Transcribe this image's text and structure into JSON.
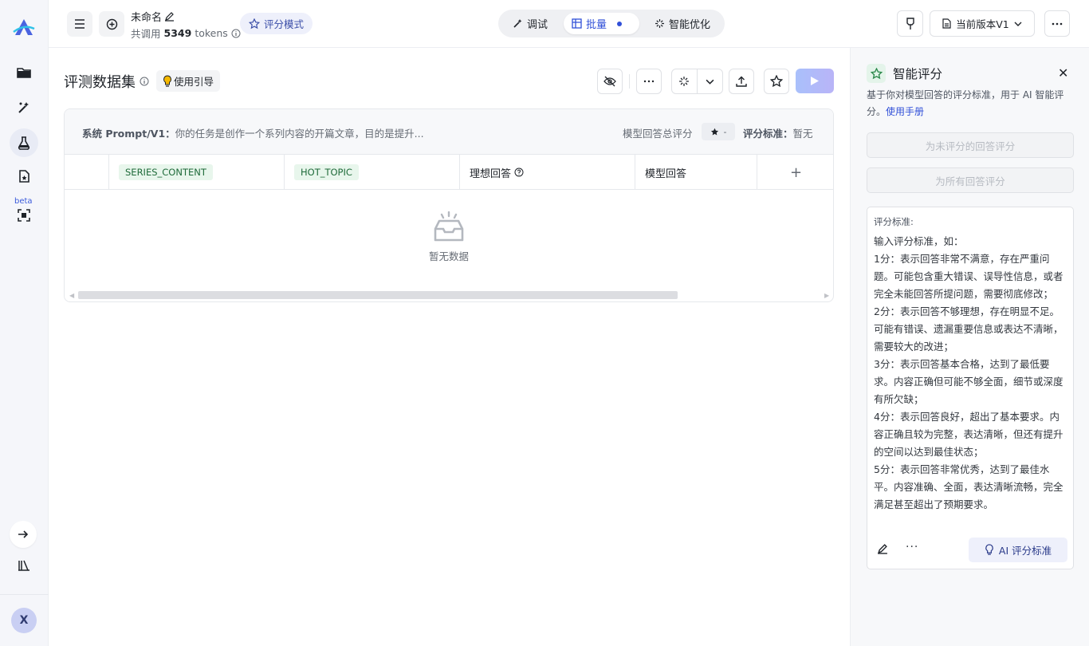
{
  "rail": {
    "beta_label": "beta",
    "avatar_initial": "X"
  },
  "topbar": {
    "title": "未命名",
    "usage_prefix": "共调用",
    "usage_tokens": "5349",
    "usage_unit": "tokens",
    "score_mode_label": "评分模式",
    "tabs": [
      {
        "label": "调试",
        "active": false
      },
      {
        "label": "批量",
        "active": true
      },
      {
        "label": "智能优化",
        "active": false
      }
    ],
    "version_label": "当前版本V1"
  },
  "main": {
    "dataset_title": "评测数据集",
    "guide_label": "使用引导",
    "prompt_prefix": "系统 Prompt/V1：",
    "prompt_text": "你的任务是创作一个系列内容的开篇文章，目的是提升...",
    "total_score_label": "模型回答总评分",
    "total_score_value": "-",
    "criteria_prefix": "评分标准：",
    "criteria_value": "暂无",
    "columns": {
      "var1": "SERIES_CONTENT",
      "var2": "HOT_TOPIC",
      "ideal": "理想回答",
      "model": "模型回答",
      "add": "+"
    },
    "empty_text": "暂无数据"
  },
  "panel": {
    "title": "智能评分",
    "description": "基于你对模型回答的评分标准，用于 AI 智能评分。",
    "manual_link": "使用手册",
    "btn_unscored": "为未评分的回答评分",
    "btn_all": "为所有回答评分",
    "criteria_label": "评分标准:",
    "criteria_text": "输入评分标准，如：\n1分：表示回答非常不满意，存在严重问题。可能包含重大错误、误导性信息，或者完全未能回答所提问题，需要彻底修改；\n2分：表示回答不够理想，存在明显不足。可能有错误、遗漏重要信息或表达不清晰，需要较大的改进；\n3分：表示回答基本合格，达到了最低要求。内容正确但可能不够全面，细节或深度有所欠缺；\n4分：表示回答良好，超出了基本要求。内容正确且较为完整，表达清晰，但还有提升的空间以达到最佳状态；\n5分：表示回答非常优秀，达到了最佳水平。内容准确、全面，表达清晰流畅，完全满足甚至超出了预期要求。",
    "ai_criteria_btn": "AI 评分标准"
  }
}
